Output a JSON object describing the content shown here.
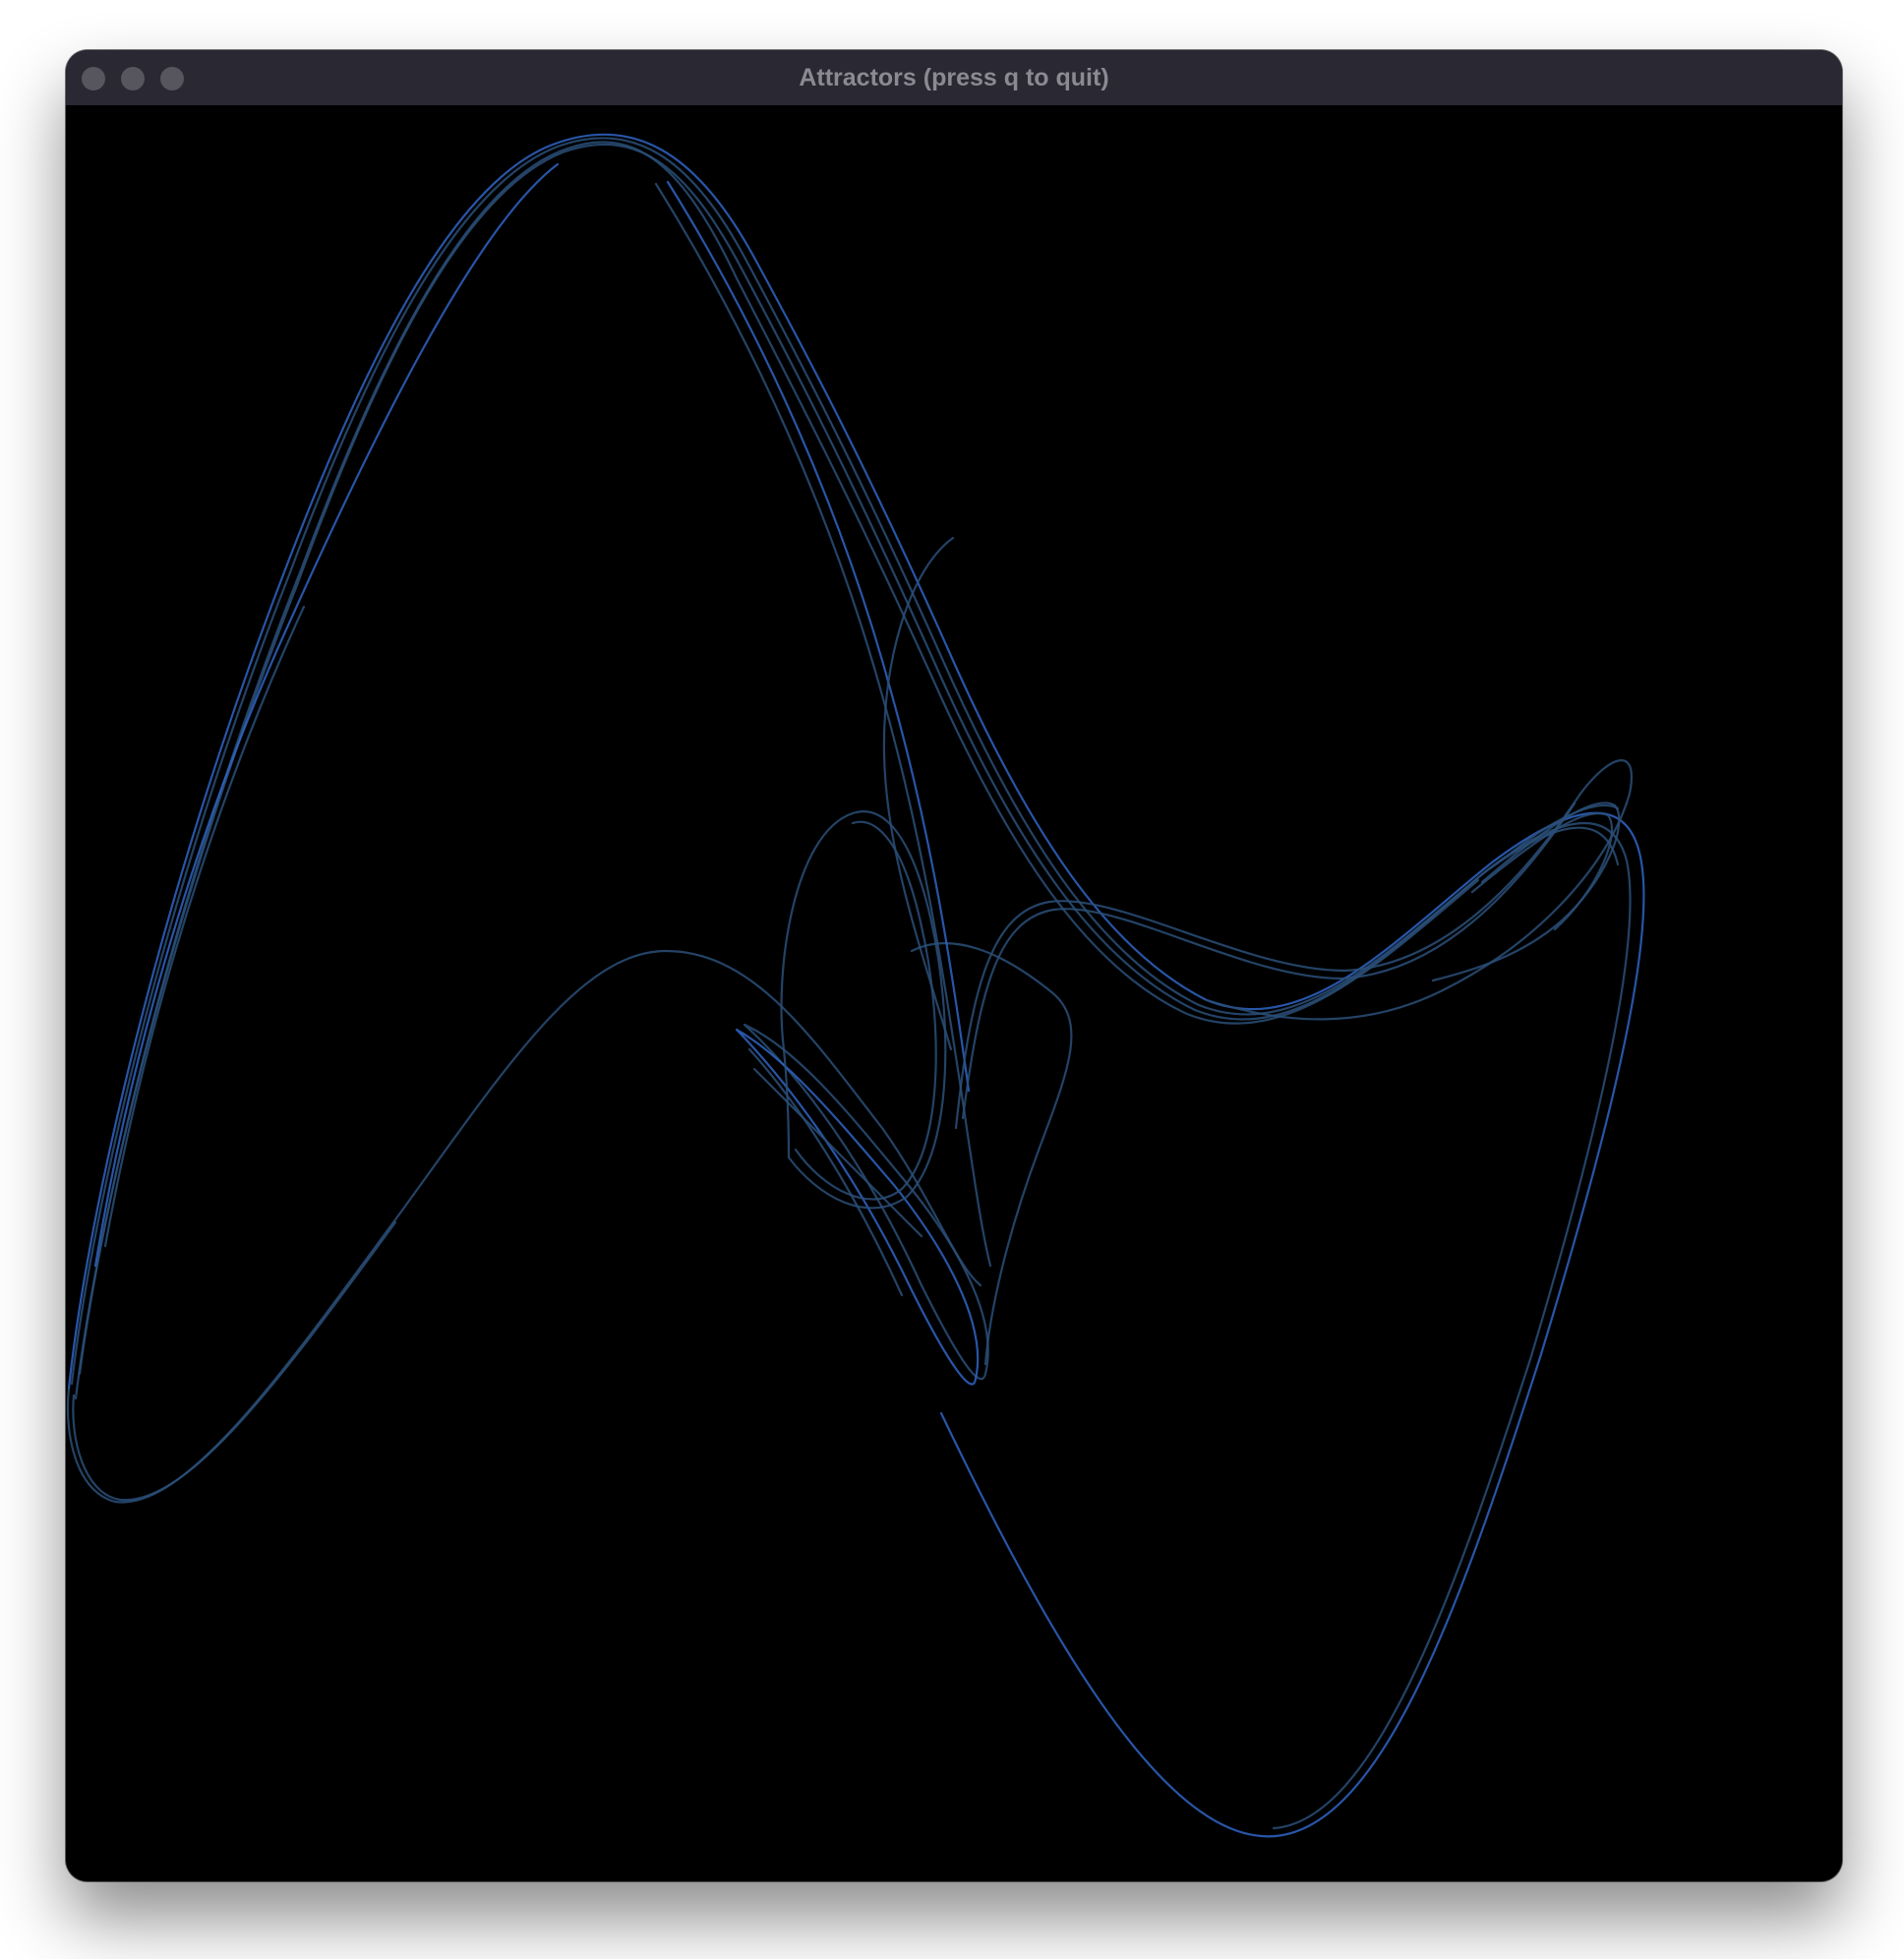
{
  "window": {
    "title": "Attractors (press q to quit)",
    "controls": [
      {
        "name": "close-button",
        "label": ""
      },
      {
        "name": "minimize-button",
        "label": ""
      },
      {
        "name": "zoom-button",
        "label": ""
      }
    ]
  },
  "canvas": {
    "background": "#000000",
    "stroke_color": "#2a4f78",
    "highlight_color": "#2f64c4"
  }
}
